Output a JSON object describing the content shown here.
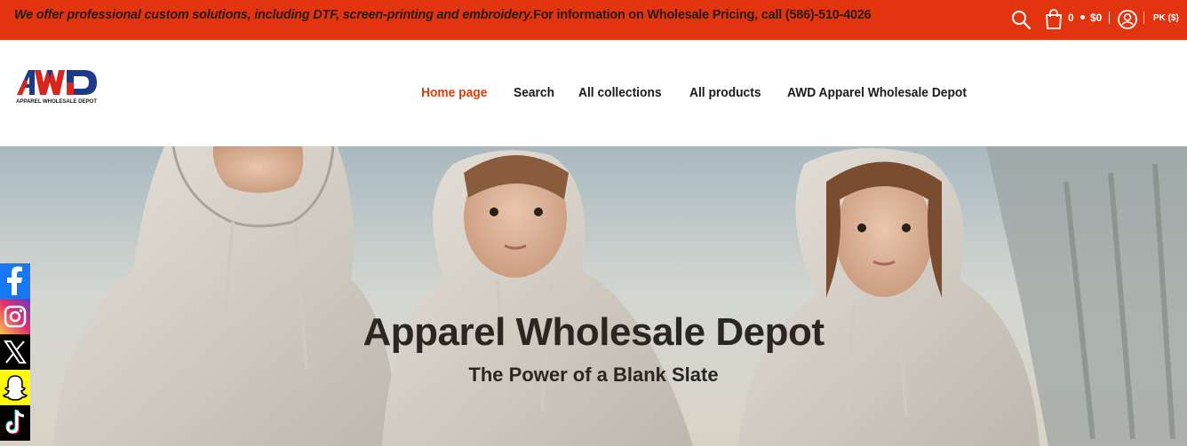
{
  "announcement": {
    "italic_text": "We offer professional custom solutions, including DTF, screen-printing and embroidery.",
    "plain_text": "For information on Wholesale Pricing, call (586)-510-4026"
  },
  "utility": {
    "search_icon": "search-icon",
    "cart_icon": "cart-icon",
    "cart_count": "0",
    "cart_total": "$0",
    "account_icon": "account-icon",
    "currency": "PK ($)"
  },
  "logo": {
    "wordmark": "AWD",
    "tagline": "Apparel Wholesale Depot"
  },
  "nav": {
    "items": [
      {
        "label": "Home page",
        "active": true
      },
      {
        "label": "Search",
        "active": false
      },
      {
        "label": "All collections",
        "active": false
      },
      {
        "label": "All products",
        "active": false
      },
      {
        "label": "AWD Apparel Wholesale Depot",
        "active": false
      }
    ]
  },
  "hero": {
    "title": "Apparel Wholesale Depot",
    "subtitle": "The Power of a Blank Slate"
  },
  "social": {
    "items": [
      {
        "icon": "facebook-icon",
        "color": "#1877f2"
      },
      {
        "icon": "instagram-icon",
        "color": "#d6249f"
      },
      {
        "icon": "x-icon",
        "color": "#000000"
      },
      {
        "icon": "snapchat-icon",
        "color": "#fffc00"
      },
      {
        "icon": "tiktok-icon",
        "color": "#000000"
      }
    ]
  },
  "colors": {
    "announcement_bg": "#e2340f",
    "nav_active": "#d9400e"
  }
}
